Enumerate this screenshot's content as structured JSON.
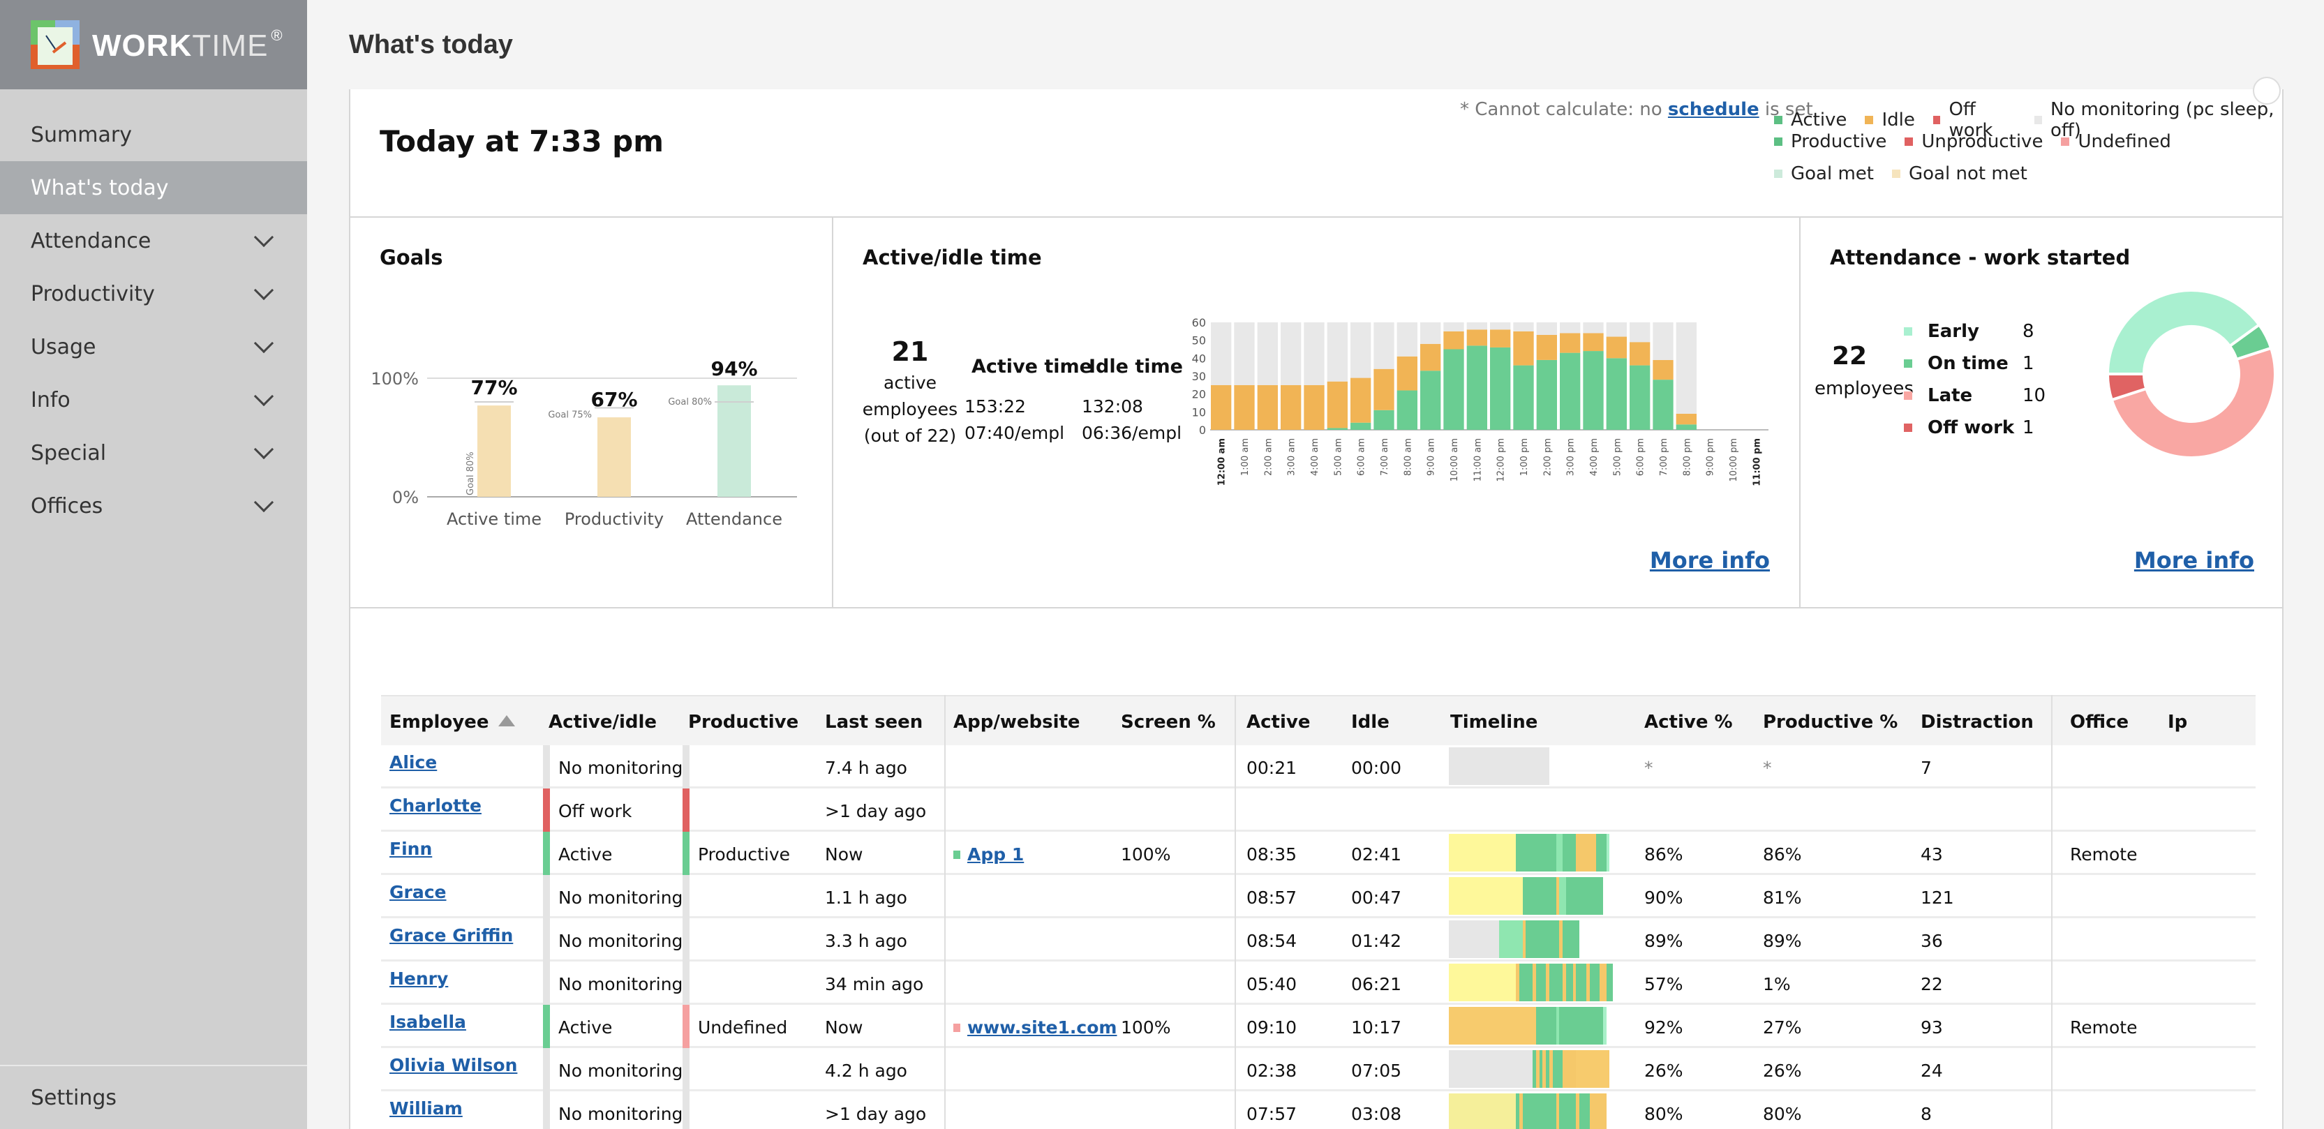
{
  "app": {
    "logo_bold": "WORK",
    "logo_light": "TIME",
    "logo_reg": "®"
  },
  "header": {
    "title": "What's today"
  },
  "sidebar": {
    "items": [
      {
        "label": "Summary",
        "active": false,
        "expandable": false
      },
      {
        "label": "What's today",
        "active": true,
        "expandable": false
      },
      {
        "label": "Attendance",
        "active": false,
        "expandable": true
      },
      {
        "label": "Productivity",
        "active": false,
        "expandable": true
      },
      {
        "label": "Usage",
        "active": false,
        "expandable": true
      },
      {
        "label": "Info",
        "active": false,
        "expandable": true
      },
      {
        "label": "Special",
        "active": false,
        "expandable": true
      },
      {
        "label": "Offices",
        "active": false,
        "expandable": true
      }
    ],
    "settings_label": "Settings"
  },
  "top": {
    "today": "Today at 7:33 pm",
    "note_prefix": "* Cannot calculate: no ",
    "note_link": "schedule",
    "note_suffix": " is set",
    "legend_rows": [
      [
        {
          "label": "Active",
          "color": "#5cbf83"
        },
        {
          "label": "Idle",
          "color": "#f0b456"
        },
        {
          "label": "Off work",
          "color": "#e06161"
        },
        {
          "label": "No monitoring (pc sleep, off)",
          "color": "#e8e8e8"
        }
      ],
      [
        {
          "label": "Productive",
          "color": "#5cbf83"
        },
        {
          "label": "Unproductive",
          "color": "#e06161"
        },
        {
          "label": "Undefined",
          "color": "#f5a0a0"
        }
      ],
      [
        {
          "label": "Goal met",
          "color": "#cdeadb"
        },
        {
          "label": "Goal not met",
          "color": "#f6e4bd"
        }
      ]
    ]
  },
  "goals": {
    "title": "Goals",
    "chart_data": {
      "type": "bar",
      "categories": [
        "Active time",
        "Productivity",
        "Attendance"
      ],
      "values": [
        77,
        67,
        94
      ],
      "value_labels": [
        "77%",
        "67%",
        "94%"
      ],
      "goals": [
        80,
        75,
        80
      ],
      "goal_labels": [
        "Goal 80%",
        "Goal 75%",
        "Goal 80%"
      ],
      "goal_met": [
        false,
        false,
        true
      ],
      "colors": {
        "met": "#c9ead9",
        "not_met": "#f5dfb2"
      },
      "yticks": [
        "0%",
        "100%"
      ],
      "ylim": [
        0,
        100
      ]
    }
  },
  "active_idle": {
    "title": "Active/idle time",
    "active_count": "21",
    "active_caption": [
      "active",
      "employees",
      "(out of 22)"
    ],
    "active_time_label": "Active time",
    "idle_time_label": "Idle time",
    "active_total": "153:22",
    "active_per": "07:40/empl",
    "idle_total": "132:08",
    "idle_per": "06:36/empl",
    "more_info": "More info",
    "chart_data": {
      "type": "bar",
      "stacked": true,
      "categories": [
        "12:00 am",
        "1:00 am",
        "2:00 am",
        "3:00 am",
        "4:00 am",
        "5:00 am",
        "6:00 am",
        "7:00 am",
        "8:00 am",
        "9:00 am",
        "10:00 am",
        "11:00 am",
        "12:00 pm",
        "1:00 pm",
        "2:00 pm",
        "3:00 pm",
        "4:00 pm",
        "5:00 pm",
        "6:00 pm",
        "7:00 pm",
        "8:00 pm",
        "9:00 pm",
        "10:00 pm",
        "11:00 pm"
      ],
      "bold_ticks": [
        "12:00 am",
        "11:00 pm"
      ],
      "series": [
        {
          "name": "Active",
          "color": "#6acd92",
          "values": [
            0,
            0,
            0,
            0,
            0,
            1,
            4,
            11,
            22,
            33,
            45,
            47,
            46,
            36,
            39,
            43,
            44,
            40,
            36,
            28,
            3,
            0,
            0,
            0
          ]
        },
        {
          "name": "Idle",
          "color": "#f1b455",
          "values": [
            25,
            25,
            25,
            25,
            25,
            26,
            25,
            23,
            19,
            15,
            10,
            9,
            10,
            19,
            14,
            11,
            10,
            12,
            13,
            11,
            6,
            0,
            0,
            0
          ]
        },
        {
          "name": "No monitoring",
          "color": "#e8e8e8",
          "values": [
            35,
            35,
            35,
            35,
            35,
            33,
            31,
            26,
            19,
            12,
            5,
            4,
            4,
            5,
            7,
            6,
            6,
            8,
            11,
            21,
            51,
            0,
            0,
            0
          ]
        }
      ],
      "yticks": [
        0,
        10,
        20,
        30,
        40,
        50,
        60
      ],
      "ylim": [
        0,
        60
      ]
    }
  },
  "attendance": {
    "title": "Attendance - work started",
    "total": "22",
    "total_caption": "employees",
    "more_info": "More info",
    "chart_data": {
      "type": "pie",
      "donut": true,
      "labels": [
        "Early",
        "On time",
        "Late",
        "Off work"
      ],
      "values": [
        8,
        1,
        10,
        1
      ],
      "colors": [
        "#a9f0d0",
        "#6acd92",
        "#f9a7a3",
        "#e06363"
      ]
    }
  },
  "table": {
    "columns": [
      "Employee",
      "Active/idle",
      "Productive",
      "Last seen",
      "App/website",
      "Screen %",
      "Active",
      "Idle",
      "Timeline",
      "Active %",
      "Productive %",
      "Distraction",
      "Office",
      "Ip"
    ],
    "sort_column": "Employee",
    "sort_dir": "asc",
    "rows": [
      {
        "employee": "Alice",
        "active_idle": "No monitoring",
        "ai_color": "#e4e4e4",
        "productive": "",
        "prod_color": "#e4e4e4",
        "last_seen": "7.4 h ago",
        "app": "",
        "app_color": "",
        "screen": "",
        "active": "00:21",
        "idle": "00:00",
        "active_pct": "*",
        "productive_pct": "*",
        "distraction": "7",
        "office": "",
        "ip": "",
        "timeline": [
          [
            "#e6e6e6",
            30
          ]
        ]
      },
      {
        "employee": "Charlotte",
        "active_idle": "Off work",
        "ai_color": "#e06161",
        "productive": "",
        "prod_color": "#e06161",
        "last_seen": ">1 day ago",
        "app": "",
        "app_color": "",
        "screen": "",
        "active": "",
        "idle": "",
        "active_pct": "",
        "productive_pct": "",
        "distraction": "",
        "office": "",
        "ip": "",
        "timeline": []
      },
      {
        "employee": "Finn",
        "active_idle": "Active",
        "ai_color": "#6acd92",
        "productive": "Productive",
        "prod_color": "#6acd92",
        "last_seen": "Now",
        "app": "App 1",
        "app_color": "#6acd92",
        "screen": "100%",
        "active": "08:35",
        "idle": "02:41",
        "active_pct": "86%",
        "productive_pct": "86%",
        "distraction": "43",
        "office": "Remote",
        "ip": "",
        "timeline": [
          [
            "#fef89a",
            20
          ],
          [
            "#6acd92",
            12
          ],
          [
            "#8fe6b0",
            2
          ],
          [
            "#6acd92",
            4
          ],
          [
            "#f5c86a",
            6
          ],
          [
            "#6acd92",
            3
          ],
          [
            "#a8f0c8",
            1
          ]
        ]
      },
      {
        "employee": "Grace",
        "active_idle": "No monitoring",
        "ai_color": "#e4e4e4",
        "productive": "",
        "prod_color": "#e4e4e4",
        "last_seen": "1.1 h ago",
        "app": "",
        "app_color": "",
        "screen": "",
        "active": "08:57",
        "idle": "00:47",
        "active_pct": "90%",
        "productive_pct": "81%",
        "distraction": "121",
        "office": "",
        "ip": "",
        "timeline": [
          [
            "#fef89a",
            22
          ],
          [
            "#6acd92",
            10
          ],
          [
            "#f5c86a",
            1
          ],
          [
            "#8fe6b0",
            2
          ],
          [
            "#6acd92",
            11
          ]
        ]
      },
      {
        "employee": "Grace Griffin",
        "active_idle": "No monitoring",
        "ai_color": "#e4e4e4",
        "productive": "",
        "prod_color": "#e4e4e4",
        "last_seen": "3.3 h ago",
        "app": "",
        "app_color": "",
        "screen": "",
        "active": "08:54",
        "idle": "01:42",
        "active_pct": "89%",
        "productive_pct": "89%",
        "distraction": "36",
        "office": "",
        "ip": "",
        "timeline": [
          [
            "#e6e6e6",
            15
          ],
          [
            "#8fe6b0",
            7
          ],
          [
            "#f5c86a",
            1
          ],
          [
            "#6acd92",
            10
          ],
          [
            "#f5c86a",
            1
          ],
          [
            "#6acd92",
            5
          ]
        ]
      },
      {
        "employee": "Henry",
        "active_idle": "No monitoring",
        "ai_color": "#e4e4e4",
        "productive": "",
        "prod_color": "#e4e4e4",
        "last_seen": "34 min ago",
        "app": "",
        "app_color": "",
        "screen": "",
        "active": "05:40",
        "idle": "06:21",
        "active_pct": "57%",
        "productive_pct": "1%",
        "distraction": "22",
        "office": "",
        "ip": "",
        "timeline": [
          [
            "#fef89a",
            20
          ],
          [
            "#f5c86a",
            1
          ],
          [
            "#6acd92",
            4
          ],
          [
            "#f5c86a",
            1
          ],
          [
            "#6acd92",
            3
          ],
          [
            "#f5c86a",
            1
          ],
          [
            "#6acd92",
            4
          ],
          [
            "#f5c86a",
            1
          ],
          [
            "#6acd92",
            2
          ],
          [
            "#f5c86a",
            1
          ],
          [
            "#6acd92",
            3
          ],
          [
            "#f5c86a",
            1
          ],
          [
            "#6acd92",
            3
          ],
          [
            "#f5c86a",
            2
          ],
          [
            "#6acd92",
            2
          ]
        ]
      },
      {
        "employee": "Isabella",
        "active_idle": "Active",
        "ai_color": "#6acd92",
        "productive": "Undefined",
        "prod_color": "#f5a0a0",
        "last_seen": "Now",
        "app": "www.site1.com",
        "app_color": "#f5a0a0",
        "screen": "100%",
        "active": "09:10",
        "idle": "10:17",
        "active_pct": "92%",
        "productive_pct": "27%",
        "distraction": "93",
        "office": "Remote",
        "ip": "",
        "timeline": [
          [
            "#f7cb6d",
            26
          ],
          [
            "#6acd92",
            6
          ],
          [
            "#8fe6b0",
            1
          ],
          [
            "#6acd92",
            13
          ],
          [
            "#a8f0c8",
            1
          ]
        ]
      },
      {
        "employee": "Olivia Wilson",
        "active_idle": "No monitoring",
        "ai_color": "#e4e4e4",
        "productive": "",
        "prod_color": "#e4e4e4",
        "last_seen": "4.2 h ago",
        "app": "",
        "app_color": "",
        "screen": "",
        "active": "02:38",
        "idle": "07:05",
        "active_pct": "26%",
        "productive_pct": "26%",
        "distraction": "24",
        "office": "",
        "ip": "",
        "timeline": [
          [
            "#e6e6e6",
            25
          ],
          [
            "#6acd92",
            1
          ],
          [
            "#f5c86a",
            1
          ],
          [
            "#6acd92",
            1
          ],
          [
            "#f5c86a",
            1
          ],
          [
            "#6acd92",
            1
          ],
          [
            "#f5c86a",
            1
          ],
          [
            "#6acd92",
            3
          ],
          [
            "#f5c86a",
            4
          ],
          [
            "#f7cb6d",
            10
          ]
        ]
      },
      {
        "employee": "William",
        "active_idle": "No monitoring",
        "ai_color": "#e4e4e4",
        "productive": "",
        "prod_color": "#e4e4e4",
        "last_seen": ">1 day ago",
        "app": "",
        "app_color": "",
        "screen": "",
        "active": "07:57",
        "idle": "03:08",
        "active_pct": "80%",
        "productive_pct": "80%",
        "distraction": "8",
        "office": "",
        "ip": "",
        "timeline": [
          [
            "#f5ef9a",
            20
          ],
          [
            "#6acd92",
            1
          ],
          [
            "#f5c86a",
            1
          ],
          [
            "#6acd92",
            10
          ],
          [
            "#f5c86a",
            1
          ],
          [
            "#6acd92",
            5
          ],
          [
            "#f5c86a",
            1
          ],
          [
            "#6acd92",
            3
          ],
          [
            "#f5c86a",
            5
          ]
        ]
      }
    ]
  }
}
